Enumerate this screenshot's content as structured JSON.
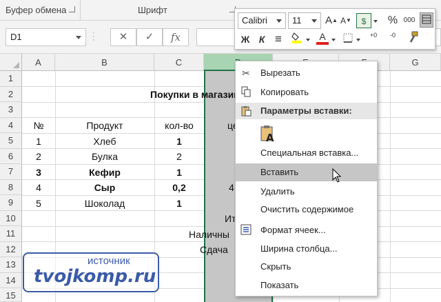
{
  "ribbon": {
    "clipboard_label": "Буфер обмена",
    "font_label": "Шрифт"
  },
  "formula_bar": {
    "name_box": "D1",
    "cancel_icon": "✕",
    "enter_icon": "✓",
    "function_icon": "fx"
  },
  "mini_toolbar": {
    "font_name": "Calibri",
    "font_size": "11",
    "grow_font": "A",
    "shrink_font": "A",
    "currency": "$",
    "percent": "%",
    "thousands": "000",
    "bold": "Ж",
    "italic": "К",
    "align": "≡",
    "font_color_letter": "A",
    "decimal_plus": "+0",
    "decimal_minus": "-0"
  },
  "columns": [
    "A",
    "B",
    "C",
    "D",
    "E",
    "F",
    "G"
  ],
  "rows": [
    "1",
    "2",
    "3",
    "4",
    "5",
    "6",
    "7",
    "8",
    "9",
    "10",
    "11",
    "12",
    "13",
    "14",
    "15"
  ],
  "sheet": {
    "title": "Покупки в магазин",
    "headers": {
      "no": "№",
      "product": "Продукт",
      "qty": "кол-во",
      "price": "це"
    },
    "items": [
      {
        "no": "1",
        "product": "Хлеб",
        "qty": "1"
      },
      {
        "no": "2",
        "product": "Булка",
        "qty": "2"
      },
      {
        "no": "3",
        "product": "Кефир",
        "qty": "1"
      },
      {
        "no": "4",
        "product": "Сыр",
        "qty": "0,2",
        "price_part": "4"
      },
      {
        "no": "5",
        "product": "Шоколад",
        "qty": "1"
      }
    ],
    "total_label": "Ит",
    "cash_label": "Наличны",
    "change_label": "Сдача"
  },
  "context_menu": {
    "cut": "Вырезать",
    "copy": "Копировать",
    "paste_options": "Параметры вставки:",
    "paste_special": "Специальная вставка...",
    "insert": "Вставить",
    "delete": "Удалить",
    "clear": "Очистить содержимое",
    "format_cells": "Формат ячеек...",
    "column_width": "Ширина столбца...",
    "hide": "Скрыть",
    "show": "Показать"
  },
  "watermark": {
    "top": "источник",
    "main": "tvojkomp.ru"
  },
  "colors": {
    "excel_green": "#217346",
    "selected_header": "#a9d4b4",
    "watermark_blue": "#3b5aa8",
    "highlight_yellow": "#ffff00",
    "font_red": "#e02020"
  }
}
